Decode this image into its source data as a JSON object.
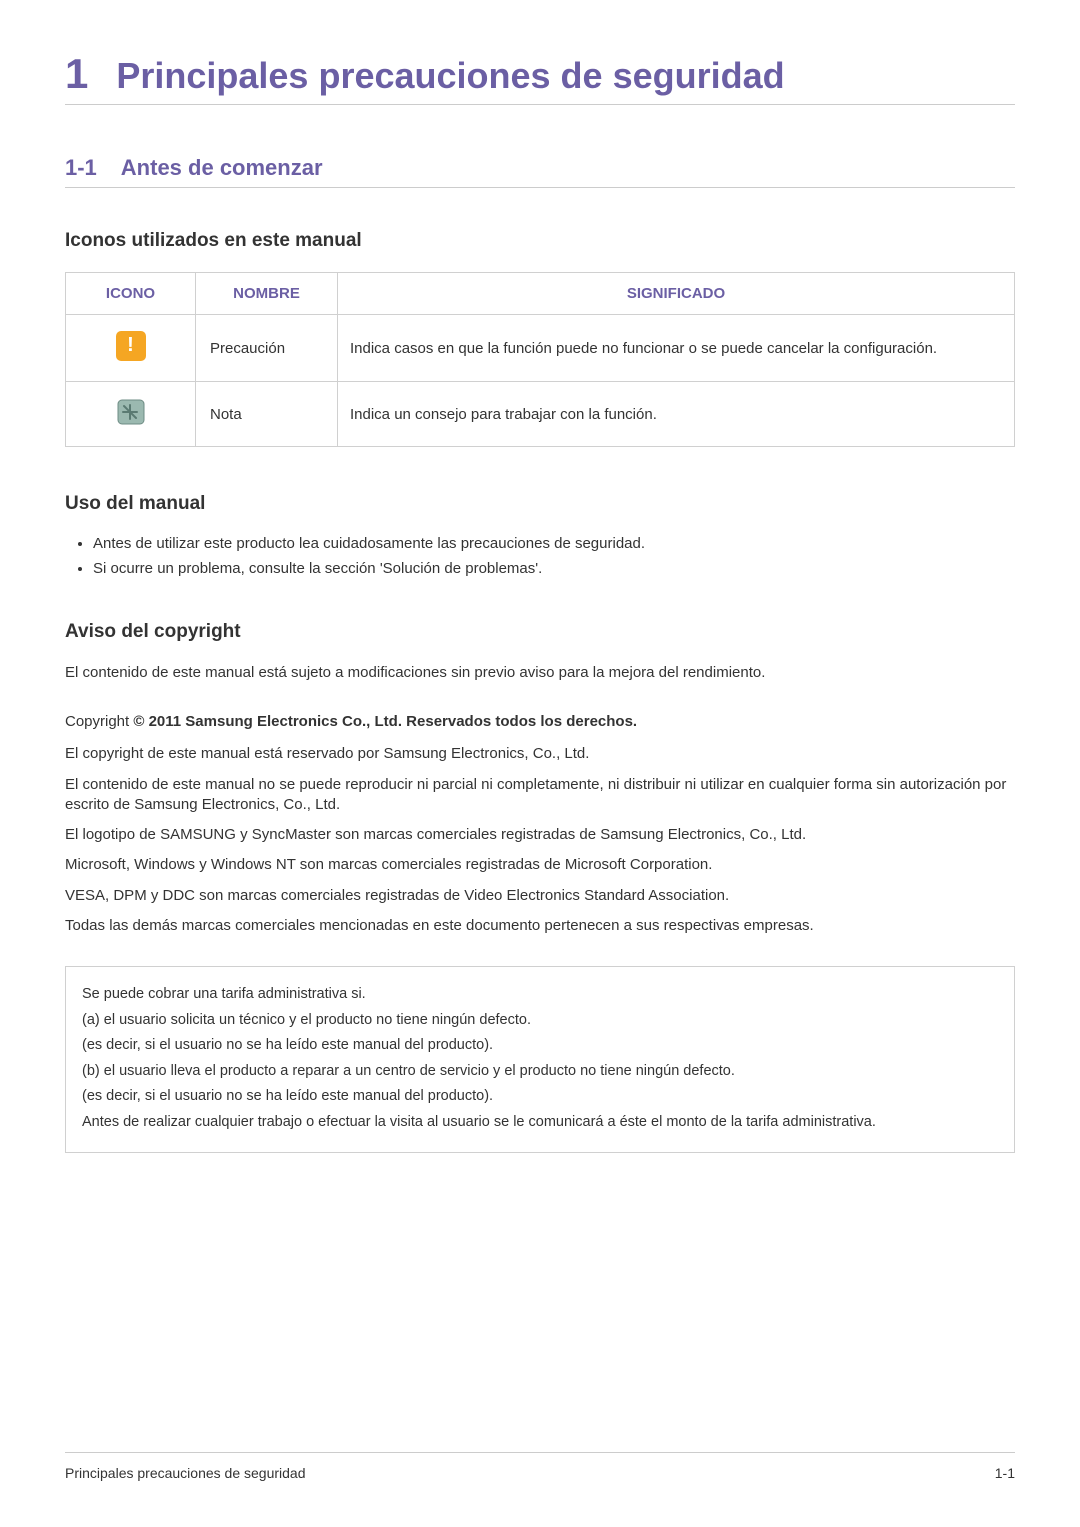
{
  "chapter": {
    "num": "1",
    "title": "Principales precauciones de seguridad"
  },
  "section": {
    "num": "1-1",
    "title": "Antes de comenzar"
  },
  "icons_heading": "Iconos utilizados en este manual",
  "icons_table": {
    "headers": {
      "icon": "ICONO",
      "name": "NOMBRE",
      "meaning": "SIGNIFICADO"
    },
    "rows": [
      {
        "name": "Precaución",
        "meaning": "Indica casos en que la función puede no funcionar o se puede cancelar la configuración."
      },
      {
        "name": "Nota",
        "meaning": "Indica un consejo para trabajar con la función."
      }
    ]
  },
  "uso_heading": "Uso del manual",
  "uso_bullets": [
    "Antes de utilizar este producto lea cuidadosamente las precauciones de seguridad.",
    "Si ocurre un problema, consulte la sección 'Solución de problemas'."
  ],
  "copyright_heading": "Aviso del copyright",
  "copyright_intro": "El contenido de este manual está sujeto a modificaciones sin previo aviso para la mejora del rendimiento.",
  "copyright_line": {
    "prefix": "Copyright ",
    "bold": "© 2011 Samsung Electronics Co., Ltd. Reservados todos los derechos."
  },
  "copyright_paras": [
    "El copyright de este manual está reservado por Samsung Electronics, Co., Ltd.",
    "El contenido de este manual no se puede reproducir ni parcial ni completamente, ni distribuir ni utilizar en cualquier forma sin autorización por escrito de Samsung Electronics, Co., Ltd.",
    "El logotipo de SAMSUNG y SyncMaster son marcas comerciales registradas de Samsung Electronics, Co., Ltd.",
    "Microsoft, Windows y Windows NT son marcas comerciales registradas de Microsoft Corporation.",
    "VESA, DPM y DDC son marcas comerciales registradas de Video Electronics Standard Association.",
    "Todas las demás marcas comerciales mencionadas en este documento pertenecen a sus respectivas empresas."
  ],
  "info_box": [
    "Se puede cobrar una tarifa administrativa si.",
    "(a) el usuario solicita un técnico y el producto no tiene ningún defecto.",
    "(es decir, si el usuario no se ha leído este manual del producto).",
    "(b) el usuario lleva el producto a reparar a un centro de servicio y el producto no tiene ningún defecto.",
    "(es decir, si el usuario no se ha leído este manual del producto).",
    "Antes de realizar cualquier trabajo o efectuar la visita al usuario se le comunicará a éste el monto de la tarifa administrativa."
  ],
  "footer": {
    "left": "Principales precauciones de seguridad",
    "right": "1-1"
  }
}
